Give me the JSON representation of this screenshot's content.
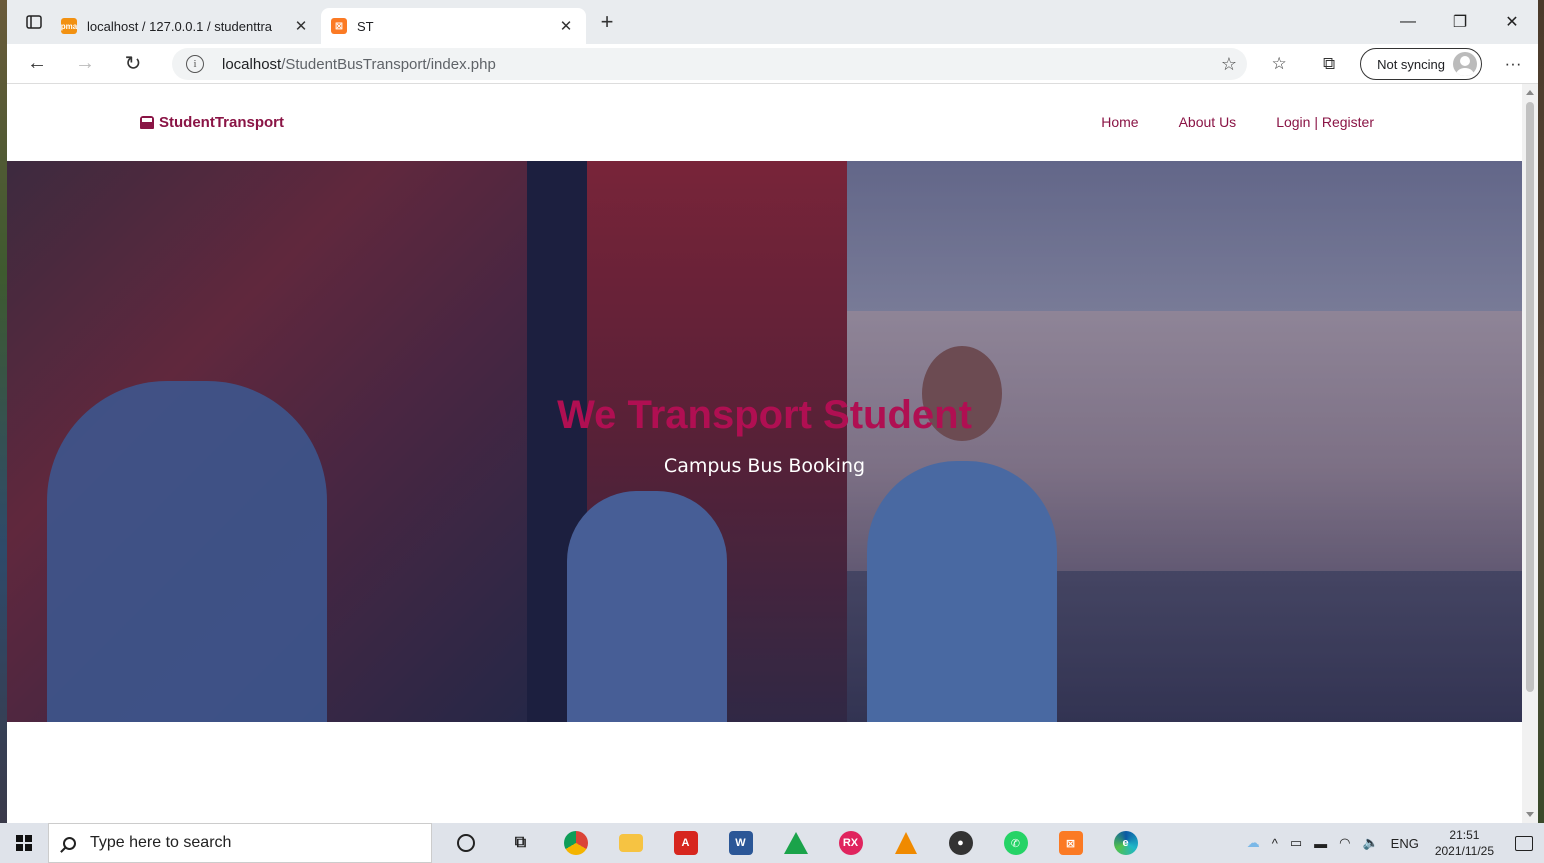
{
  "browser": {
    "tabs": [
      {
        "title": "localhost / 127.0.0.1 / studenttra",
        "favicon": "phpmyadmin-icon",
        "active": false
      },
      {
        "title": "ST",
        "favicon": "xampp-icon",
        "active": true
      }
    ],
    "url_host": "localhost",
    "url_path": "/StudentBusTransport/index.php",
    "sync_label": "Not syncing"
  },
  "site": {
    "brand": "StudentTransport",
    "nav": {
      "home": "Home",
      "about": "About Us",
      "login": "Login | Register"
    },
    "hero": {
      "title": "We Transport Student",
      "subtitle": "Campus Bus Booking"
    },
    "colors": {
      "accent": "#8a1445",
      "hero_title": "#b00f52"
    }
  },
  "taskbar": {
    "search_placeholder": "Type here to search",
    "apps": [
      "cortana-icon",
      "task-view-icon",
      "chrome-icon",
      "file-explorer-icon",
      "acrobat-icon",
      "word-icon",
      "android-studio-icon",
      "rx-icon",
      "vlc-icon",
      "media-player-icon",
      "whatsapp-icon",
      "xampp-icon",
      "edge-icon"
    ],
    "language": "ENG",
    "time": "21:51",
    "date": "2021/11/25"
  }
}
